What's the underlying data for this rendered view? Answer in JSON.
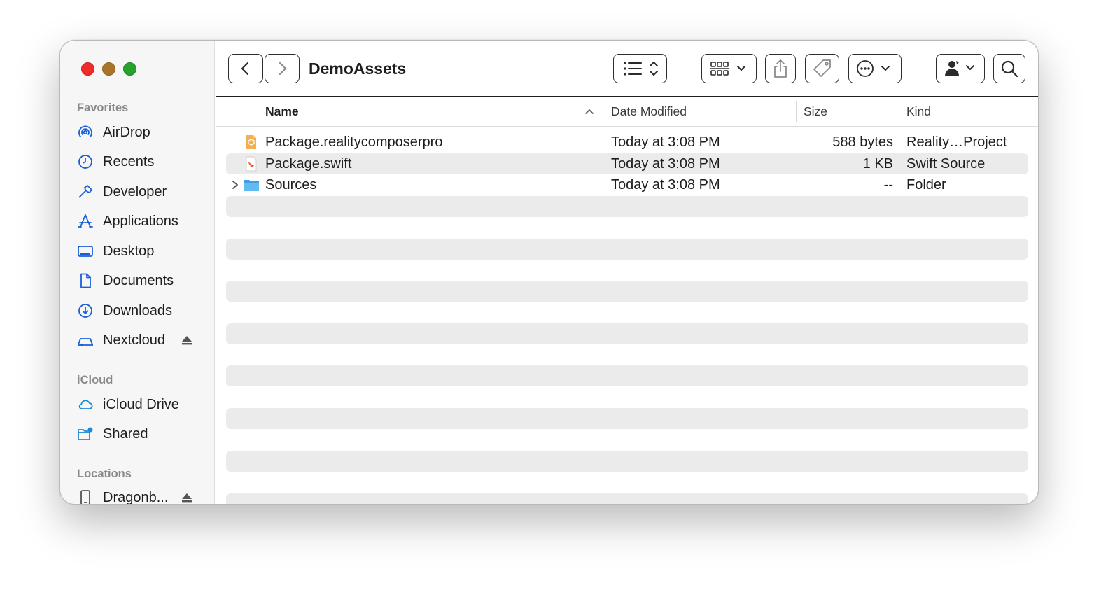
{
  "window": {
    "title": "DemoAssets"
  },
  "sidebar": {
    "sections": [
      {
        "title": "Favorites",
        "items": [
          {
            "label": "AirDrop",
            "icon": "airdrop-icon"
          },
          {
            "label": "Recents",
            "icon": "clock-icon"
          },
          {
            "label": "Developer",
            "icon": "hammer-icon"
          },
          {
            "label": "Applications",
            "icon": "applications-icon"
          },
          {
            "label": "Desktop",
            "icon": "desktop-icon"
          },
          {
            "label": "Documents",
            "icon": "document-icon"
          },
          {
            "label": "Downloads",
            "icon": "download-icon"
          },
          {
            "label": "Nextcloud",
            "icon": "drive-icon",
            "ejectable": true
          }
        ]
      },
      {
        "title": "iCloud",
        "items": [
          {
            "label": "iCloud Drive",
            "icon": "cloud-icon"
          },
          {
            "label": "Shared",
            "icon": "shared-folder-icon"
          }
        ]
      },
      {
        "title": "Locations",
        "items": [
          {
            "label": "Dragonb...",
            "icon": "phone-icon",
            "ejectable": true
          }
        ]
      }
    ]
  },
  "toolbar": {
    "back_icon": "chevron-left-icon",
    "forward_icon": "chevron-right-icon",
    "view_icon": "list-view-icon",
    "group_icon": "grid-icon",
    "share_icon": "share-icon",
    "tag_icon": "tag-icon",
    "action_icon": "ellipsis-circle-icon",
    "profile_icon": "user-icon",
    "search_icon": "search-icon"
  },
  "columns": {
    "name": "Name",
    "date": "Date Modified",
    "size": "Size",
    "kind": "Kind"
  },
  "files": [
    {
      "name": "Package.realitycomposerpro",
      "date": "Today at 3:08 PM",
      "size": "588 bytes",
      "kind": "Reality…Project",
      "icon": "reality-project-icon"
    },
    {
      "name": "Package.swift",
      "date": "Today at 3:08 PM",
      "size": "1 KB",
      "kind": "Swift Source",
      "icon": "swift-file-icon"
    },
    {
      "name": "Sources",
      "date": "Today at 3:08 PM",
      "size": "--",
      "kind": "Folder",
      "icon": "folder-icon",
      "expandable": true
    }
  ],
  "colors": {
    "sidebar_icon": "#1a5fd6",
    "accent_folder": "#5ab0e6",
    "row_alt": "#ebebeb"
  }
}
